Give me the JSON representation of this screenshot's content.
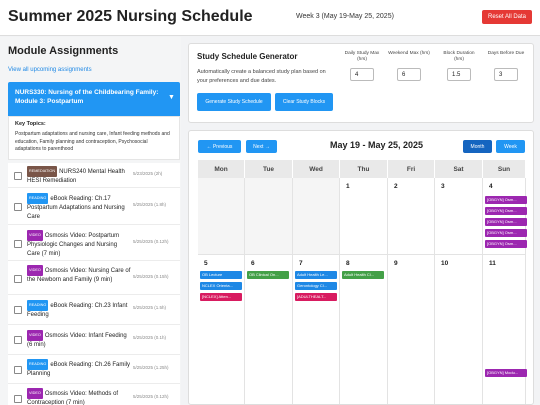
{
  "header": {
    "title": "Summer 2025 Nursing Schedule",
    "week": "Week 3 (May 19-May 25, 2025)",
    "reset_label": "Reset All Data"
  },
  "sidebar": {
    "title": "Module Assignments",
    "view_all": "View all upcoming assignments",
    "module": "NURS330: Nursing of the Childbearing Family: Module 3: Postpartum",
    "module_chevron": "▼",
    "key_topics_label": "Key Topics:",
    "key_topics": "Postpartum adaptations and nursing care, Infant feeding methods and education, Family planning and contraception, Psychosocial adaptations to parenthood",
    "tasks": [
      {
        "tag": "REMEDIATION",
        "text": "NURS240 Mental Health HESI Remediation",
        "date": "5/23/2025 (2h)"
      },
      {
        "tag": "READING",
        "text": "eBook Reading: Ch.17 Postpartum Adaptations and Nursing Care",
        "date": "5/25/2025 (1.8h)"
      },
      {
        "tag": "VIDEO",
        "text": "Osmosis Video: Postpartum Physiologic Changes and Nursing Care (7 min)",
        "date": "5/25/2025 (0.12h)"
      },
      {
        "tag": "VIDEO",
        "text": "Osmosis Video: Nursing Care of the Newborn and Family (9 min)",
        "date": "5/25/2025 (0.15h)"
      },
      {
        "tag": "READING",
        "text": "eBook Reading: Ch.23 Infant Feeding",
        "date": "5/25/2025 (1.5h)"
      },
      {
        "tag": "VIDEO",
        "text": "Osmosis Video: Infant Feeding (6 min)",
        "date": "5/25/2025 (0.1h)"
      },
      {
        "tag": "READING",
        "text": "eBook Reading: Ch.26 Family Planning",
        "date": "5/25/2025 (1.25h)"
      },
      {
        "tag": "VIDEO",
        "text": "Osmosis Video: Methods of Contraception (7 min)",
        "date": "5/25/2025 (0.12h)"
      }
    ]
  },
  "generator": {
    "title": "Study Schedule Generator",
    "description": "Automatically create a balanced study plan based on your preferences and due dates.",
    "generate_label": "Generate Study Schedule",
    "clear_label": "Clear Study Blocks",
    "params": [
      {
        "label": "Daily Study Max (hrs)",
        "value": "4"
      },
      {
        "label": "Weekend Max (hrs)",
        "value": "6"
      },
      {
        "label": "Block Duration (hrs)",
        "value": "1.5"
      },
      {
        "label": "Days Before Due",
        "value": "3"
      }
    ]
  },
  "calendar": {
    "prev_label": "← Previous",
    "next_label": "Next →",
    "title": "May 19 - May 25, 2025",
    "month_label": "Month",
    "week_label": "Week",
    "days": [
      "Mon",
      "Tue",
      "Wed",
      "Thu",
      "Fri",
      "Sat",
      "Sun"
    ],
    "row1": [
      "",
      "",
      "",
      "1",
      "2",
      "3",
      "4"
    ],
    "row2": [
      "5",
      "6",
      "7",
      "8",
      "9",
      "10",
      "11"
    ],
    "events": {
      "sun4": [
        "[OBGYN] Osm...",
        "[OBGYN] Osm...",
        "[OBGYN] Osm...",
        "[OBGYN] Osm...",
        "[OBGYN] Osm..."
      ],
      "mon5": [
        "OB Lecture",
        "NCLEX Orienta...",
        "[NCLEX] Atten..."
      ],
      "tue6": [
        "OB Clinical On..."
      ],
      "wed7": [
        "Adult Health Le...",
        "Gerontology Cl...",
        "[ADULTHEALT..."
      ],
      "thu8": [
        "Adult Health Cl..."
      ],
      "sun11": [
        "[OBGYN] Modu..."
      ]
    },
    "colors": {
      "green": "#43a047",
      "blue": "#1e88e5",
      "pink": "#d81b60",
      "purple": "#9c27b0",
      "accent": "#2196f3",
      "dark": "#1565c0"
    }
  }
}
